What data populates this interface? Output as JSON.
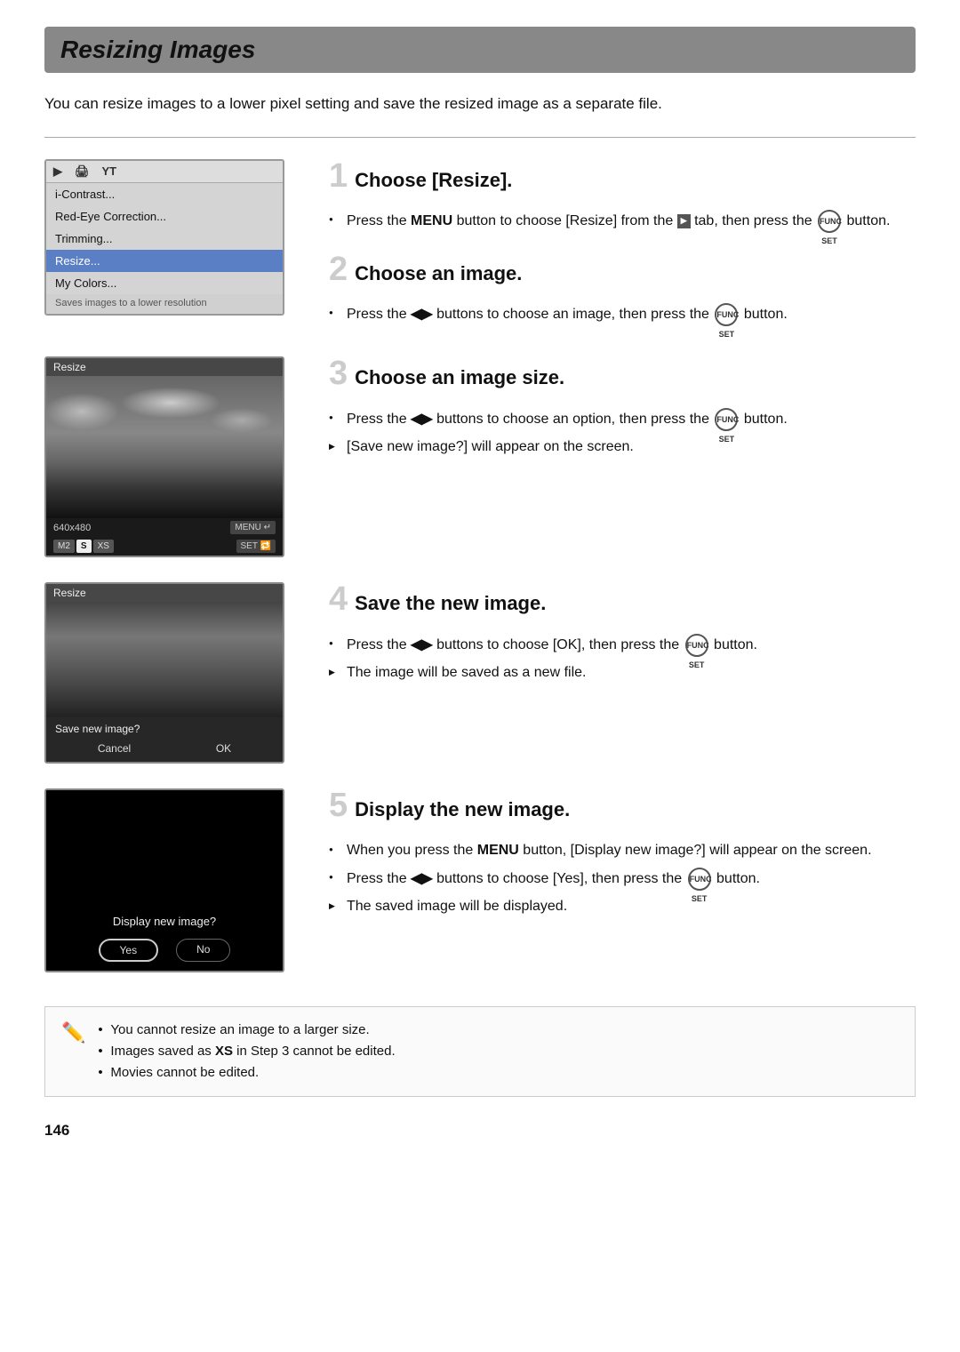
{
  "page": {
    "title": "Resizing Images",
    "page_number": "146",
    "intro": "You can resize images to a lower pixel setting and save the resized image as a separate file."
  },
  "steps": [
    {
      "number": "1",
      "heading": "Choose [Resize].",
      "bullets": [
        {
          "type": "bullet",
          "text": "Press the MENU button to choose [Resize] from the ▶ tab, then press the FUNC/SET button."
        }
      ]
    },
    {
      "number": "2",
      "heading": "Choose an image.",
      "bullets": [
        {
          "type": "bullet",
          "text": "Press the ◀▶ buttons to choose an image, then press the FUNC/SET button."
        }
      ]
    },
    {
      "number": "3",
      "heading": "Choose an image size.",
      "bullets": [
        {
          "type": "bullet",
          "text": "Press the ◀▶ buttons to choose an option, then press the FUNC/SET button."
        },
        {
          "type": "arrow",
          "text": "[Save new image?] will appear on the screen."
        }
      ]
    },
    {
      "number": "4",
      "heading": "Save the new image.",
      "bullets": [
        {
          "type": "bullet",
          "text": "Press the ◀▶ buttons to choose [OK], then press the FUNC/SET button."
        },
        {
          "type": "arrow",
          "text": "The image will be saved as a new file."
        }
      ]
    },
    {
      "number": "5",
      "heading": "Display the new image.",
      "bullets": [
        {
          "type": "bullet",
          "text": "When you press the MENU button, [Display new image?] will appear on the screen."
        },
        {
          "type": "bullet",
          "text": "Press the ◀▶ buttons to choose [Yes], then press the FUNC/SET button."
        },
        {
          "type": "arrow",
          "text": "The saved image will be displayed."
        }
      ]
    }
  ],
  "screen1": {
    "tabs": [
      "▶",
      "🖨",
      "YT"
    ],
    "menu_items": [
      "i-Contrast...",
      "Red-Eye Correction...",
      "Trimming...",
      "Resize...",
      "My Colors..."
    ],
    "selected": "Resize...",
    "caption": "Saves images to a lower resolution"
  },
  "screen2": {
    "label": "Resize",
    "size_text": "640x480",
    "buttons": [
      "M2",
      "S",
      "XS"
    ],
    "active_btn": "S"
  },
  "screen3": {
    "label": "Resize",
    "dialog_text": "Save new image?",
    "buttons": [
      "Cancel",
      "OK"
    ]
  },
  "screen4": {
    "dialog_text": "Display new image?",
    "buttons": [
      "Yes",
      "No"
    ],
    "selected_btn": "Yes"
  },
  "notes": [
    "You cannot resize an image to a larger size.",
    "Images saved as XS in Step 3 cannot be edited.",
    "Movies cannot be edited."
  ]
}
